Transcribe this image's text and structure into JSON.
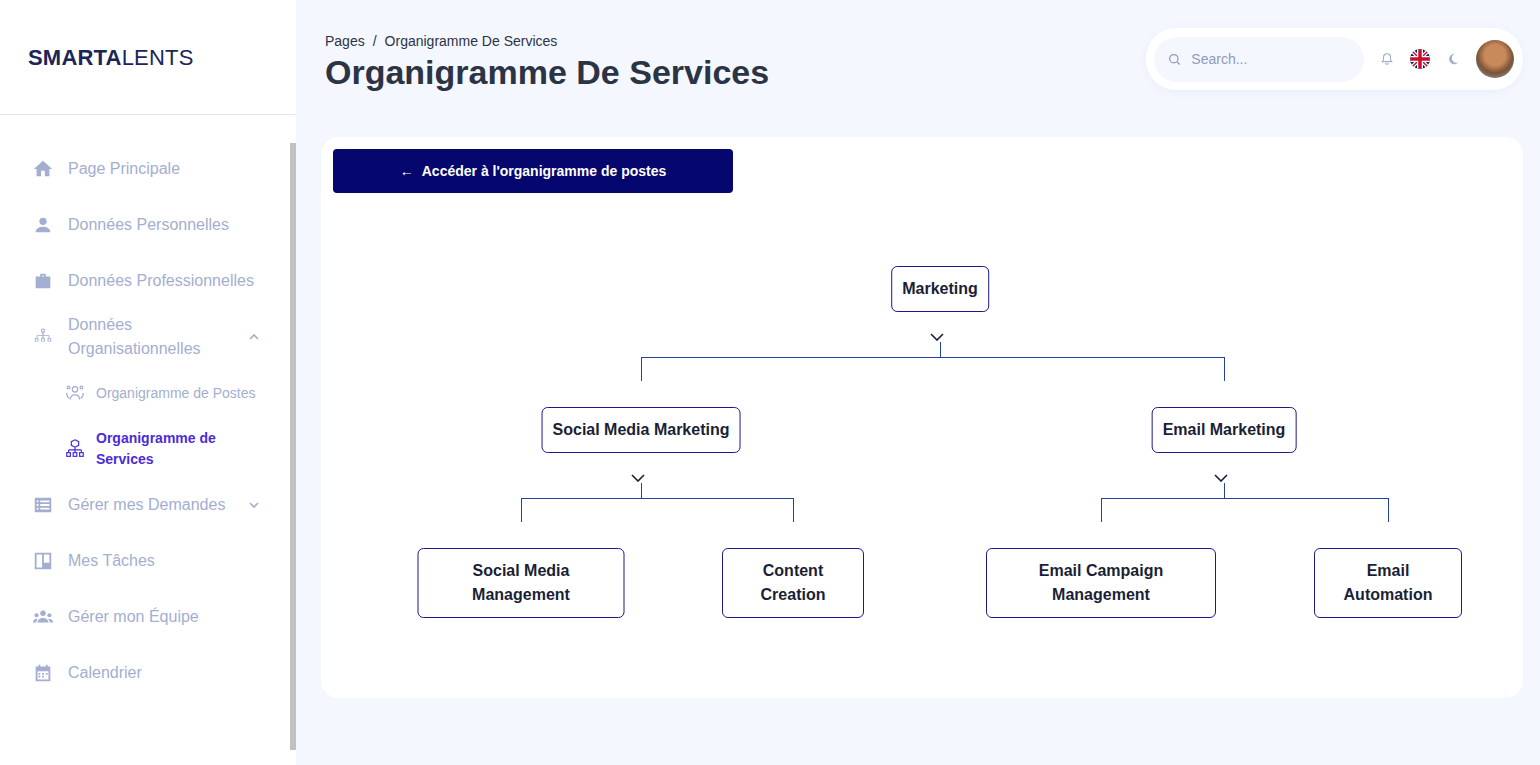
{
  "logo": {
    "bold": "SMARTA",
    "light": "LENTS"
  },
  "breadcrumb": {
    "items": [
      "Pages",
      "Organigramme De Services"
    ],
    "separator": "/"
  },
  "page_title": "Organigramme De Services",
  "search": {
    "placeholder": "Search..."
  },
  "sidebar": {
    "items": [
      {
        "label": "Page Principale",
        "selected": false
      },
      {
        "label": "Données Personnelles",
        "selected": false
      },
      {
        "label": "Données Professionnelles",
        "selected": false
      },
      {
        "label": "Données Organisationnelles",
        "selected": false,
        "expanded": true,
        "children": [
          {
            "label": "Organigramme de Postes",
            "selected": false
          },
          {
            "label": "Organigramme de Services",
            "selected": true
          }
        ]
      },
      {
        "label": "Gérer mes Demandes",
        "selected": false,
        "expanded": false
      },
      {
        "label": "Mes Tâches",
        "selected": false
      },
      {
        "label": "Gérer mon Équipe",
        "selected": false
      },
      {
        "label": "Calendrier",
        "selected": false
      }
    ]
  },
  "switch_button": {
    "arrow": "←",
    "label": "Accéder à l'organigramme de postes"
  },
  "tree": {
    "root": {
      "label": "Marketing",
      "expanded": true,
      "children": [
        {
          "label": "Social Media Marketing",
          "expanded": true,
          "children": [
            {
              "label": "Social Media Management"
            },
            {
              "label": "Content Creation"
            }
          ]
        },
        {
          "label": "Email Marketing",
          "expanded": true,
          "children": [
            {
              "label": "Email Campaign Management"
            },
            {
              "label": "Email Automation"
            }
          ]
        }
      ]
    }
  }
}
